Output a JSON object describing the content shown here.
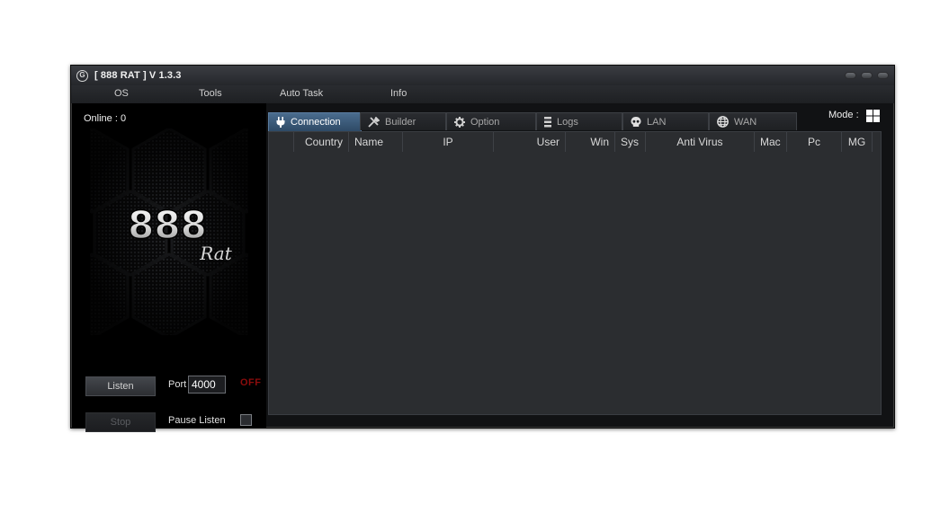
{
  "window": {
    "title": "[ 888 RAT ] V 1.3.3"
  },
  "menu": [
    {
      "label": "OS"
    },
    {
      "label": "Tools"
    },
    {
      "label": "Auto Task"
    },
    {
      "label": "Info"
    }
  ],
  "sidebar": {
    "online": "Online : 0",
    "logo_number": "888",
    "logo_word": "Rat",
    "listen_label": "Listen",
    "port_label": "Port",
    "port_value": "4000",
    "status": "OFF",
    "stop_label": "Stop",
    "pause_label": "Pause Listen"
  },
  "tabs": [
    {
      "label": "Connection",
      "icon": "plug-icon",
      "active": true
    },
    {
      "label": "Builder",
      "icon": "tools-icon",
      "active": false
    },
    {
      "label": "Option",
      "icon": "gear-icon",
      "active": false
    },
    {
      "label": "Logs",
      "icon": "logs-icon",
      "active": false
    },
    {
      "label": "LAN",
      "icon": "skull-icon",
      "active": false
    },
    {
      "label": "WAN",
      "icon": "globe-icon",
      "active": false
    }
  ],
  "mode": {
    "label": "Mode :",
    "icon": "windows-icon"
  },
  "columns": [
    "Country",
    "Name",
    "IP",
    "User",
    "Win",
    "Sys",
    "Anti Virus",
    "Mac",
    "Pc",
    "MG"
  ],
  "colors": {
    "active_tab": "#4a6c8e",
    "status_off": "#8b0c0c",
    "grid_background": "#2b2d30"
  }
}
